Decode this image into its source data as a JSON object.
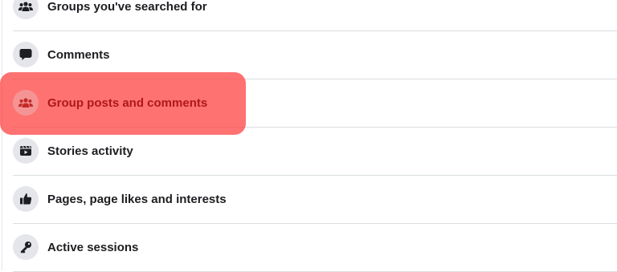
{
  "activity_list": {
    "items": [
      {
        "label": "Groups you've searched for",
        "icon": "groups-icon"
      },
      {
        "label": "Comments",
        "icon": "comment-bubble-icon"
      },
      {
        "label": "Group posts and comments",
        "icon": "groups-icon",
        "highlighted": true
      },
      {
        "label": "Stories activity",
        "icon": "stories-clapper-icon"
      },
      {
        "label": "Pages, page likes and interests",
        "icon": "thumbs-up-icon"
      },
      {
        "label": "Active sessions",
        "icon": "key-icon"
      }
    ]
  },
  "colors": {
    "highlight": "#ff3c3c",
    "highlight_text": "#b01818",
    "icon_bg": "#e4e6eb",
    "divider": "#dadde1",
    "text": "#1c1e21"
  }
}
